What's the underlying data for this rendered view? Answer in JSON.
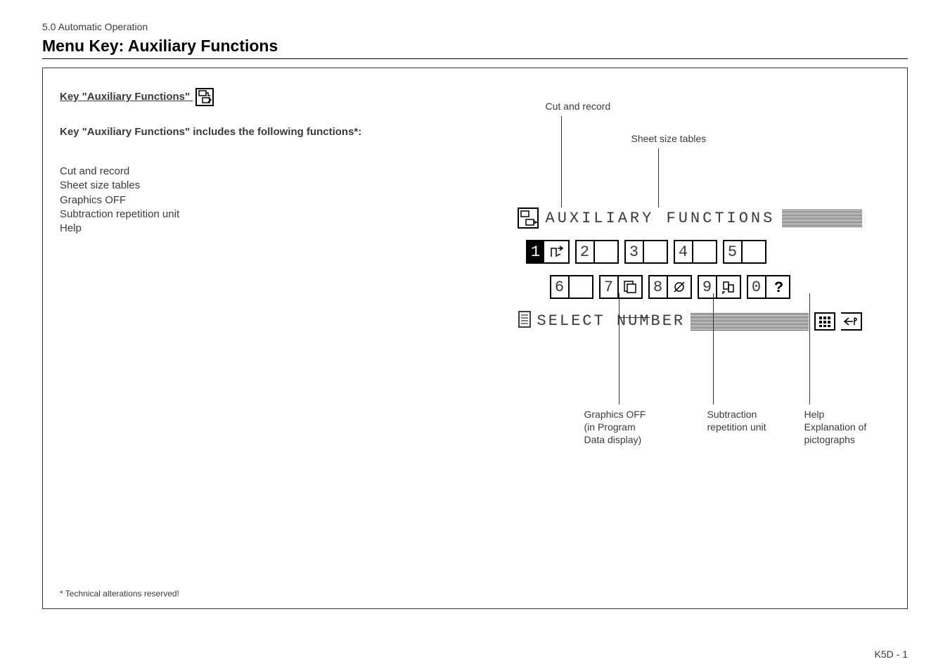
{
  "header": {
    "section": "5.0 Automatic Operation",
    "title": "Menu Key: Auxiliary Functions"
  },
  "left": {
    "key_heading": "Key \"Auxiliary Functions\"",
    "sub_heading": "Key \"Auxiliary Functions\" includes the following functions*:",
    "items": {
      "i1": "Cut and record",
      "i2": "Sheet size tables",
      "i3": "Graphics OFF",
      "i4": "Subtraction repetition unit",
      "i5": "Help"
    },
    "footnote": "* Technical alterations reserved!"
  },
  "diagram": {
    "callout_cut_record": "Cut and record",
    "callout_sheet_size": "Sheet size tables",
    "lcd_title": "AUXILIARY FUNCTIONS",
    "keys": {
      "k1": "1",
      "k2": "2",
      "k3": "3",
      "k4": "4",
      "k5": "5",
      "k6": "6",
      "k7": "7",
      "k8": "8",
      "k9": "9",
      "k0": "0"
    },
    "lcd_bottom": "SELECT NUMBER",
    "callout_graphics_l1": "Graphics OFF",
    "callout_graphics_l2": "(in Program",
    "callout_graphics_l3": "Data display)",
    "callout_subtraction_l1": "Subtraction",
    "callout_subtraction_l2": "repetition unit",
    "callout_help_l1": "Help",
    "callout_help_l2": "Explanation of",
    "callout_help_l3": "pictographs"
  },
  "page_number": "K5D - 1"
}
